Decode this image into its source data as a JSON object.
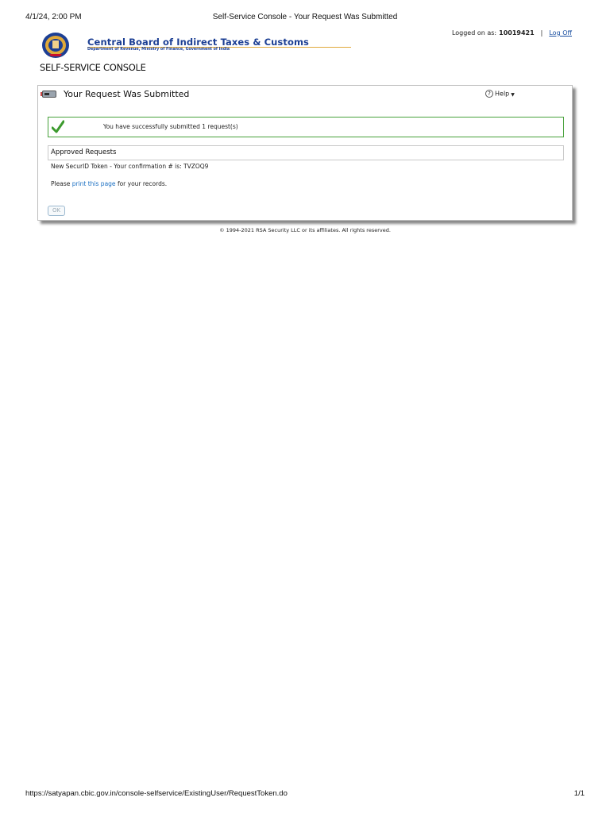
{
  "print_header": {
    "date": "4/1/24, 2:00 PM",
    "page_title": "Self-Service Console - Your Request Was Submitted"
  },
  "logon": {
    "label": "Logged on as:",
    "user_id": "10019421",
    "separator": "|",
    "logoff_label": "Log Off"
  },
  "brand": {
    "name": "Central Board of Indirect Taxes & Customs",
    "subtitle": "Department of Revenue, Ministry of Finance, Government of India",
    "colors": {
      "primary": "#1c3f94",
      "accent": "#e0a93a"
    }
  },
  "console_title": "SELF-SERVICE CONSOLE",
  "panel": {
    "icon": "token-icon",
    "title": "Your Request Was Submitted",
    "help_label": "Help",
    "success_message": "You have successfully submitted 1 request(s)",
    "success_color": "#47a13a",
    "approved_header": "Approved Requests",
    "confirmation": "New SecurID Token - Your confirmation # is: TVZOQ9",
    "print_prefix": "Please",
    "print_link": "print this page",
    "print_suffix": "for your records.",
    "ok_label": "OK"
  },
  "copyright": "© 1994-2021 RSA Security LLC or its affiliates. All rights reserved.",
  "print_footer": {
    "url": "https://satyapan.cbic.gov.in/console-selfservice/ExistingUser/RequestToken.do",
    "page": "1/1"
  }
}
